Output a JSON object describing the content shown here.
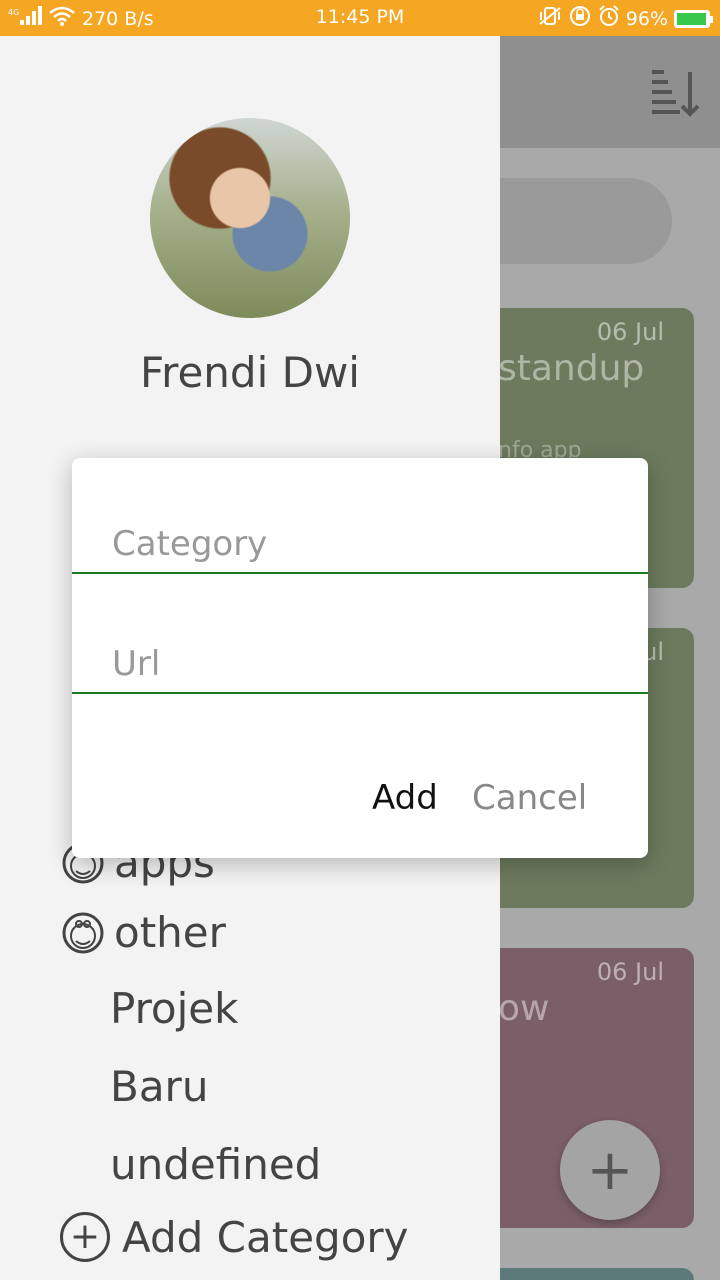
{
  "status_bar": {
    "network": "4G",
    "speed": "270 B/s",
    "time": "11:45 PM",
    "battery": "96%",
    "battery_level": 0.96
  },
  "background": {
    "cards": [
      {
        "date": "06 Jul",
        "title": "standup",
        "subtitle": "nfo app"
      },
      {
        "date": "ul",
        "title": "",
        "subtitle": ""
      },
      {
        "date": "06 Jul",
        "title": "ow",
        "subtitle": ""
      }
    ],
    "fab_label": "+"
  },
  "drawer": {
    "user_name": "Frendi Dwi",
    "items": [
      {
        "label": "apps",
        "icon": "doraemon-icon"
      },
      {
        "label": "other",
        "icon": "doraemon-icon"
      },
      {
        "label": "Projek",
        "icon": ""
      },
      {
        "label": "Baru",
        "icon": ""
      },
      {
        "label": "undefined",
        "icon": ""
      }
    ],
    "add_category": "Add Category"
  },
  "dialog": {
    "category_placeholder": "Category",
    "url_placeholder": "Url",
    "add_label": "Add",
    "cancel_label": "Cancel"
  },
  "colors": {
    "status_bar": "#f5a623",
    "accent_line": "#1b7a2a",
    "drawer_bg": "#f3f3f3"
  }
}
